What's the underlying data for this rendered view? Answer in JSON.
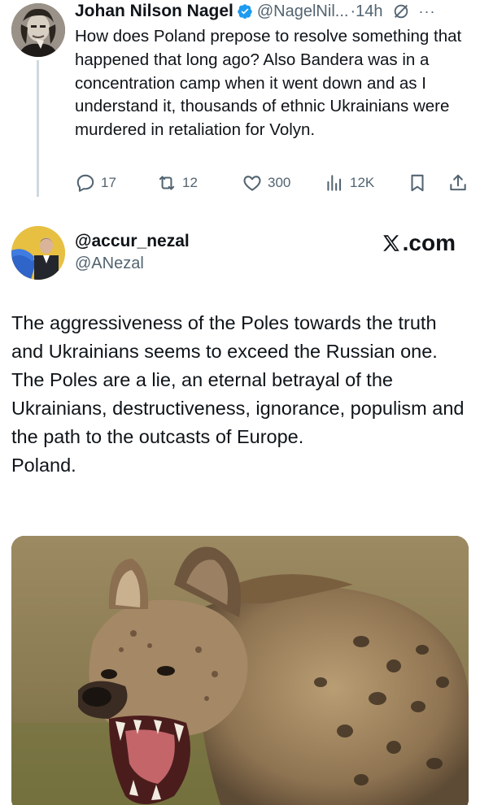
{
  "tweet": {
    "display_name": "Johan Nilson Nagel",
    "handle": "@NagelNil...",
    "time": "·14h",
    "more": "···",
    "text": "How does Poland prepose to resolve something that happened that long ago? Also Bandera was in a concentration camp when it went down and as I understand it, thousands of ethnic Ukrainians were murdered in retaliation for Volyn.",
    "stats": {
      "replies": "17",
      "reposts": "12",
      "likes": "300",
      "views": "12K"
    },
    "icons": [
      "verified-badge-icon",
      "grok-icon",
      "reply-icon",
      "repost-icon",
      "like-icon",
      "views-icon",
      "bookmark-icon",
      "share-icon"
    ]
  },
  "quoted_post": {
    "display_name": "@accur_nezal",
    "handle": "@ANezal",
    "brand": ".com",
    "text_main": "The aggressiveness of the Poles towards the truth and Ukrainians seems to exceed the Russian one. The Poles are a lie, an eternal betrayal of the Ukrainians, destructiveness, ignorance, populism and the path to the outcasts of Europe.",
    "text_end": "Poland."
  },
  "colors": {
    "text": "#0f1419",
    "secondary": "#536471",
    "verified": "#1d9bf0",
    "thread_line": "#cfd9de"
  }
}
